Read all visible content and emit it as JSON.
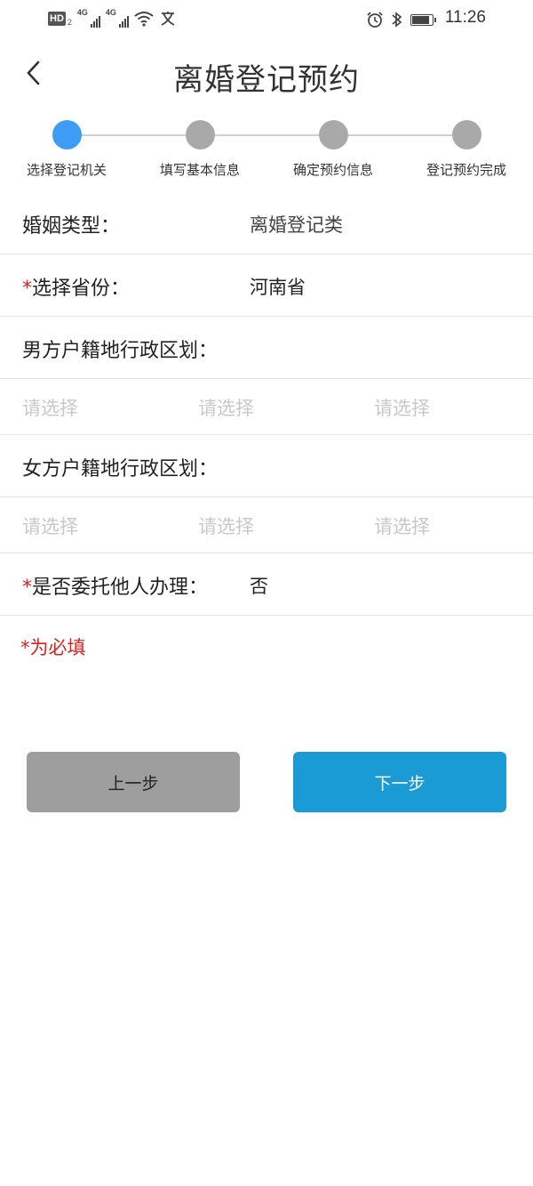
{
  "status_bar": {
    "hd_label": "HD",
    "hd_sub": "2",
    "network_1": "4G",
    "network_2": "4G",
    "time": "11:26",
    "battery_level": 0.8
  },
  "header": {
    "title": "离婚登记预约"
  },
  "stepper": {
    "steps": [
      {
        "label": "选择登记机关",
        "active": true
      },
      {
        "label": "填写基本信息",
        "active": false
      },
      {
        "label": "确定预约信息",
        "active": false
      },
      {
        "label": "登记预约完成",
        "active": false
      }
    ]
  },
  "form": {
    "marriage_type": {
      "label": "婚姻类型：",
      "value": "离婚登记类"
    },
    "province": {
      "required_mark": "*",
      "label": "选择省份：",
      "value": "河南省"
    },
    "male_region": {
      "label": "男方户籍地行政区划：",
      "options": [
        "请选择",
        "请选择",
        "请选择"
      ]
    },
    "female_region": {
      "label": "女方户籍地行政区划：",
      "options": [
        "请选择",
        "请选择",
        "请选择"
      ]
    },
    "entrust": {
      "required_mark": "*",
      "label": "是否委托他人办理：",
      "value": "否"
    },
    "required_note": "*为必填"
  },
  "buttons": {
    "prev_label": "上一步",
    "next_label": "下一步"
  },
  "colors": {
    "accent": "#3d9cf5",
    "next_button": "#1a9bd6",
    "prev_button": "#9e9e9e",
    "required": "#e02020",
    "inactive_step": "#a9a9a9"
  }
}
